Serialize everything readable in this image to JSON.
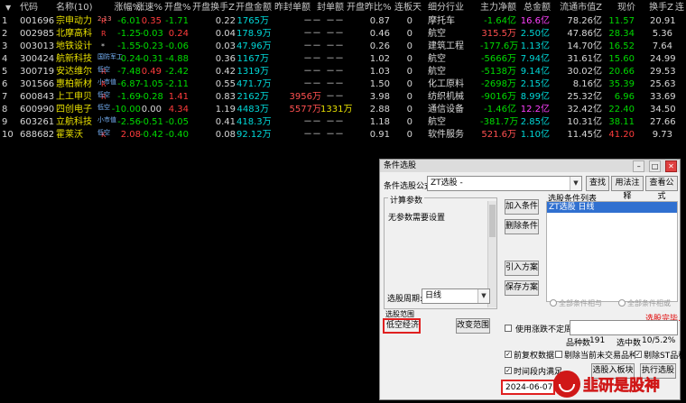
{
  "table": {
    "headers": [
      "代码",
      "名称(10)",
      "涨幅%",
      "涨速%",
      "开盘%",
      "开盘换手Z",
      "开盘金额",
      "昨封单额",
      "封单额",
      "开盘昨比%",
      "连板天",
      "细分行业",
      "主力净额",
      "总金额",
      "流通市值Z",
      "现价",
      "换手Z",
      "连"
    ],
    "rows": [
      {
        "no": "1",
        "code": "001696",
        "name": "宗申动力",
        "tag": "2.13",
        "flag": "R",
        "chg": "-6.01",
        "spd": "0.35",
        "open": "-1.71",
        "turn": "0.22",
        "amt": "1765万",
        "pre": "－－",
        "seal": "－－",
        "ratio": "0.87",
        "days": "0",
        "ind": "摩托车",
        "net": "-1.64亿",
        "tot": "16.6亿",
        "cap": "78.26亿",
        "price": "11.57",
        "turnz": "20.91"
      },
      {
        "no": "2",
        "code": "002985",
        "name": "北摩高科",
        "tag": "",
        "flag": "R",
        "chg": "-1.25",
        "spd": "-0.03",
        "open": "0.24",
        "turn": "0.04",
        "amt": "178.9万",
        "pre": "－－",
        "seal": "－－",
        "ratio": "0.46",
        "days": "0",
        "ind": "航空",
        "net": "315.5万",
        "tot": "2.50亿",
        "cap": "47.86亿",
        "price": "28.34",
        "turnz": "5.36"
      },
      {
        "no": "3",
        "code": "003013",
        "name": "地铁设计",
        "tag": "",
        "flag": "*",
        "chg": "-1.55",
        "spd": "-0.23",
        "open": "-0.06",
        "turn": "0.03",
        "amt": "47.96万",
        "pre": "－－",
        "seal": "－－",
        "ratio": "0.26",
        "days": "0",
        "ind": "建筑工程",
        "net": "-177.6万",
        "tot": "1.13亿",
        "cap": "14.70亿",
        "price": "16.52",
        "turnz": "7.64"
      },
      {
        "no": "4",
        "code": "300424",
        "name": "航新科技",
        "tag": "国防军工",
        "flag": "",
        "chg": "-0.24",
        "spd": "-0.31",
        "open": "-4.88",
        "turn": "0.36",
        "amt": "1167万",
        "pre": "－－",
        "seal": "－－",
        "ratio": "1.02",
        "days": "0",
        "ind": "航空",
        "net": "-5666万",
        "tot": "7.94亿",
        "cap": "31.61亿",
        "price": "15.60",
        "turnz": "24.99"
      },
      {
        "no": "5",
        "code": "300719",
        "name": "安达维尔",
        "tag": "低空",
        "flag": "R",
        "chg": "-7.48",
        "spd": "0.49",
        "open": "-2.42",
        "turn": "0.42",
        "amt": "1319万",
        "pre": "－－",
        "seal": "－－",
        "ratio": "1.03",
        "days": "0",
        "ind": "航空",
        "net": "-5138万",
        "tot": "9.14亿",
        "cap": "30.02亿",
        "price": "20.66",
        "turnz": "29.53"
      },
      {
        "no": "6",
        "code": "301566",
        "name": "惠柏新材",
        "tag": "小市值",
        "flag": "R",
        "chg": "-6.87",
        "spd": "-1.05",
        "open": "-2.11",
        "turn": "0.55",
        "amt": "471.7万",
        "pre": "－－",
        "seal": "－－",
        "ratio": "1.50",
        "days": "0",
        "ind": "化工原料",
        "net": "-2698万",
        "tot": "2.15亿",
        "cap": "8.16亿",
        "price": "35.39",
        "turnz": "25.63"
      },
      {
        "no": "7",
        "code": "600843",
        "name": "上工申贝",
        "tag": "低空",
        "flag": "R",
        "chg": "-1.69",
        "spd": "-0.28",
        "open": "1.41",
        "turn": "0.83",
        "amt": "2162万",
        "pre": "3956万",
        "seal": "－－",
        "ratio": "3.98",
        "days": "0",
        "ind": "纺织机械",
        "net": "-9016万",
        "tot": "8.99亿",
        "cap": "25.32亿",
        "price": "6.96",
        "turnz": "33.69"
      },
      {
        "no": "8",
        "code": "600990",
        "name": "四创电子",
        "tag": "低空",
        "flag": "",
        "chg": "-10.00",
        "spd": "0.00",
        "open": "4.34",
        "turn": "1.19",
        "amt": "4483万",
        "pre": "5577万",
        "seal": "1331万",
        "ratio": "2.88",
        "days": "0",
        "ind": "通信设备",
        "net": "-1.46亿",
        "tot": "12.2亿",
        "cap": "32.42亿",
        "price": "22.40",
        "turnz": "34.50"
      },
      {
        "no": "9",
        "code": "603261",
        "name": "立航科技",
        "tag": "小市值",
        "flag": "",
        "chg": "-2.56",
        "spd": "-0.51",
        "open": "-0.05",
        "turn": "0.41",
        "amt": "418.3万",
        "pre": "－－",
        "seal": "－－",
        "ratio": "1.18",
        "days": "0",
        "ind": "航空",
        "net": "-381.7万",
        "tot": "2.85亿",
        "cap": "10.31亿",
        "price": "38.11",
        "turnz": "27.66"
      },
      {
        "no": "10",
        "code": "688682",
        "name": "霍莱沃",
        "tag": "低空",
        "flag": "K",
        "chg": "2.08",
        "spd": "-0.42",
        "open": "-0.40",
        "turn": "0.08",
        "amt": "92.12万",
        "pre": "－－",
        "seal": "－－",
        "ratio": "0.91",
        "days": "0",
        "ind": "软件服务",
        "net": "521.6万",
        "tot": "1.10亿",
        "cap": "11.45亿",
        "price": "41.20",
        "turnz": "9.73"
      }
    ]
  },
  "dialog": {
    "title": "条件选股",
    "formula_label": "条件选股公式",
    "formula_value": "ZT选股  -",
    "btn_find": "查找",
    "btn_usage": "用法注释",
    "btn_view": "查看公式",
    "params_title": "计算参数",
    "params_text": "无参数需要设置",
    "btn_add": "加入条件",
    "btn_delete": "删除条件",
    "btn_import": "引入方案",
    "btn_save": "保存方案",
    "list_title": "选股条件列表",
    "list_items": [
      "ZT选股  日线"
    ],
    "period_label": "选股周期:",
    "period_value": "日线",
    "radio_and": "全部条件相与",
    "radio_or": "全部条件相或",
    "status_text": "选股完毕.",
    "scope_label": "选股范围",
    "scope_value": "低空经济",
    "btn_change_scope": "改变范围",
    "chk_uncertain": "使用涨跌不定周期",
    "count_label": "品种数",
    "count_value": "191",
    "selected_label": "选中数",
    "selected_value": "10/5.2%",
    "chk_fq": "前复权数据",
    "chk_untraded": "剔除当前未交易品种",
    "chk_st": "剔除ST品种",
    "chk_time": "时间段内满足",
    "btn_to_board": "选股入板块",
    "btn_execute": "执行选股",
    "date_value": "2024-06-07"
  },
  "watermark": "韭研是股神"
}
